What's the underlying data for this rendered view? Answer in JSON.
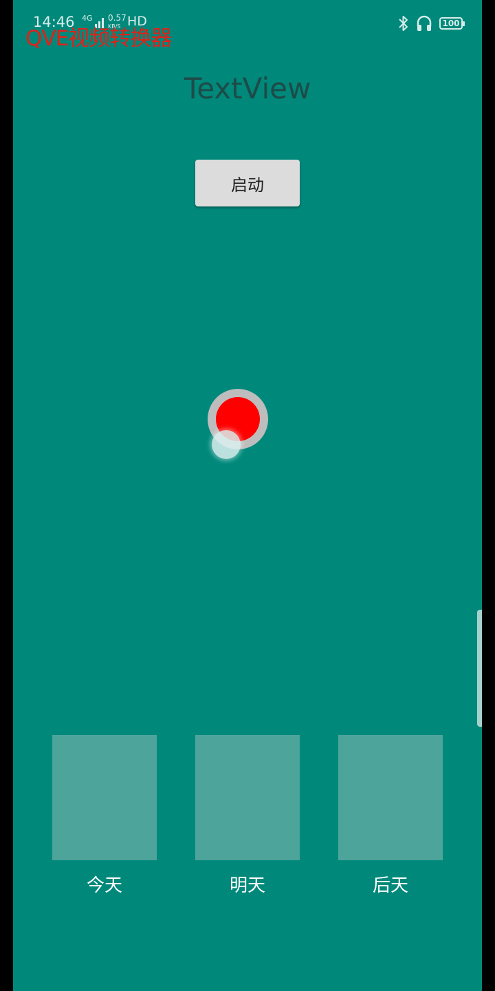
{
  "status_bar": {
    "time": "14:46",
    "network": "4G",
    "speed": "0.57",
    "speed_unit": "KB/S",
    "hd": "HD",
    "battery": "100"
  },
  "watermark": "QVE视频转换器",
  "title": "TextView",
  "start_button_label": "启动",
  "days": [
    {
      "label": "今天"
    },
    {
      "label": "明天"
    },
    {
      "label": "后天"
    }
  ],
  "colors": {
    "background": "#00897b",
    "tile": "#4da49b",
    "ball": "#ff0000",
    "ring": "#bdbdbd",
    "watermark": "#e0211a"
  },
  "icons": [
    "bluetooth-icon",
    "headphones-icon",
    "battery-icon",
    "signal-icon"
  ]
}
